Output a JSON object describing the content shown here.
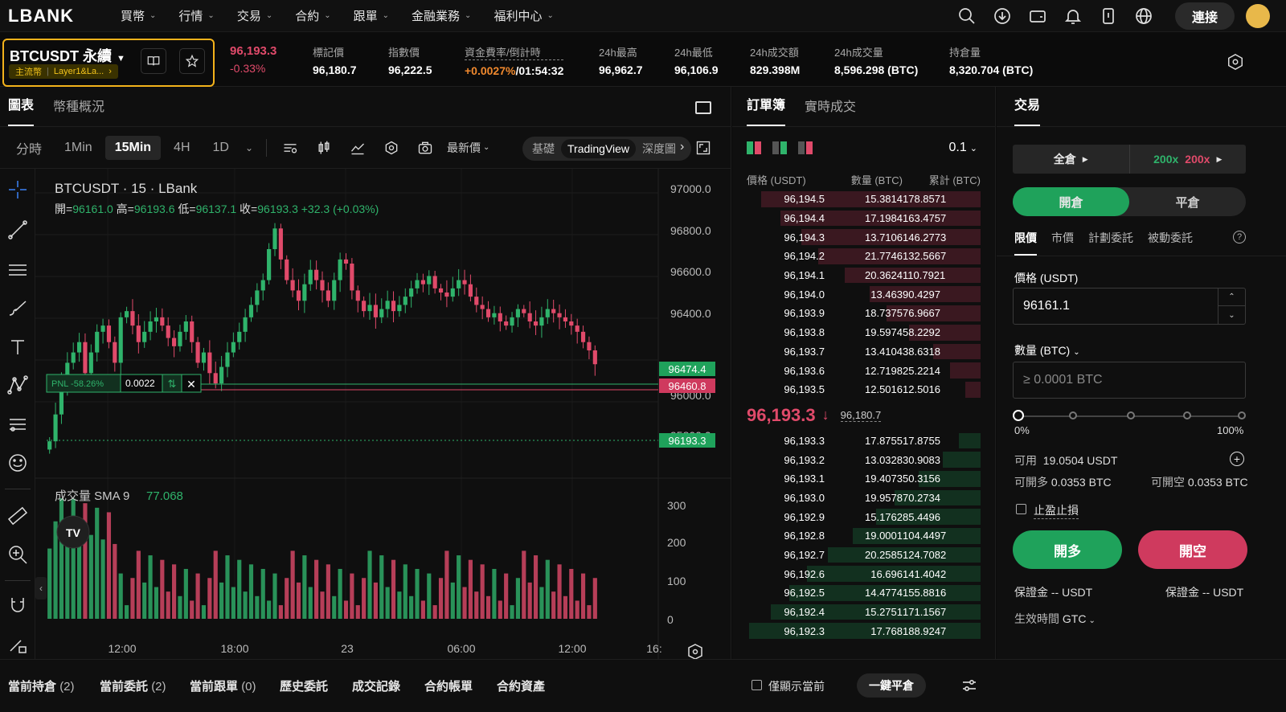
{
  "nav": {
    "logo": "LBANK",
    "items": [
      "買幣",
      "行情",
      "交易",
      "合約",
      "跟單",
      "金融業務",
      "福利中心"
    ],
    "connect": "連接"
  },
  "ticker": {
    "symbol": "BTCUSDT 永續",
    "tag1": "主流幣",
    "tag2": "Layer1&La...",
    "price": "96,193.3",
    "change": "-0.33%",
    "stats": [
      {
        "label": "標記價",
        "value": "96,180.7"
      },
      {
        "label": "指數價",
        "value": "96,222.5"
      },
      {
        "label": "資金費率/倒計時",
        "value": "+0.0027%",
        "value2": "/01:54:32"
      },
      {
        "label": "24h最高",
        "value": "96,962.7"
      },
      {
        "label": "24h最低",
        "value": "96,106.9"
      },
      {
        "label": "24h成交額",
        "value": "829.398M"
      },
      {
        "label": "24h成交量",
        "value": "8,596.298 (BTC)"
      },
      {
        "label": "持倉量",
        "value": "8,320.704 (BTC)"
      }
    ]
  },
  "chart": {
    "tabs": [
      "圖表",
      "幣種概況"
    ],
    "timeframes": [
      "分時",
      "1Min",
      "15Min",
      "4H",
      "1D"
    ],
    "active_timeframe": "15Min",
    "latest": "最新價",
    "modes": [
      "基礎",
      "TradingView",
      "深度圖"
    ],
    "title": "BTCUSDT · 15 · LBank",
    "ohlc": {
      "o_label": "開=",
      "o": "96161.0",
      "h_label": "高=",
      "h": "96193.6",
      "l_label": "低=",
      "l": "96137.1",
      "c_label": "收=",
      "c": "96193.3",
      "chg": "+32.3 (+0.03%)"
    },
    "pnl": {
      "label": "PNL -58.26%",
      "qty": "0.0022"
    },
    "price_axis": [
      "97000.0",
      "96800.0",
      "96600.0",
      "96400.0",
      "96000.0",
      "95800.0"
    ],
    "price_tags": {
      "a": "96474.4",
      "b": "96460.8",
      "c": "96193.3"
    },
    "volume_label": "成交量 SMA 9",
    "volume_value": "77.068",
    "volume_axis": [
      "300",
      "200",
      "100",
      "0"
    ],
    "time_axis": [
      "12:00",
      "18:00",
      "23",
      "06:00",
      "12:00",
      "16:"
    ]
  },
  "chart_data": {
    "type": "bar",
    "title": "BTCUSDT · 15 · LBank",
    "xlabel": "",
    "ylabel": "",
    "ylim": [
      95700,
      97100
    ],
    "note_series": "candlestick close prices (approx)",
    "closes": [
      95820,
      95950,
      96100,
      96200,
      96250,
      96300,
      96150,
      96250,
      96350,
      96380,
      96300,
      96200,
      96420,
      96450,
      96380,
      96300,
      96350,
      96400,
      96420,
      96380,
      96320,
      96280,
      96350,
      96400,
      96300,
      96200,
      96250,
      96150,
      96100,
      96180,
      96250,
      96300,
      96350,
      96420,
      96480,
      96550,
      96600,
      96750,
      96850,
      96700,
      96600,
      96550,
      96500,
      96580,
      96650,
      96600,
      96550,
      96500,
      96600,
      96700,
      96680,
      96550,
      96500,
      96450,
      96480,
      96420,
      96460,
      96500,
      96450,
      96480,
      96520,
      96560,
      96600,
      96580,
      96620,
      96560,
      96540,
      96520,
      96560,
      96600,
      96580,
      96520,
      96480,
      96460,
      96420,
      96440,
      96400,
      96380,
      96420,
      96460,
      96440,
      96400,
      96380,
      96420,
      96460,
      96440,
      96420,
      96400,
      96380,
      96350,
      96300,
      96260,
      96193
    ]
  },
  "orderbook": {
    "tabs": [
      "訂單簿",
      "實時成交"
    ],
    "step": "0.1",
    "headers": [
      "價格 (USDT)",
      "數量 (BTC)",
      "累計 (BTC)"
    ],
    "asks": [
      [
        "96,194.5",
        "15.3814",
        "178.8571"
      ],
      [
        "96,194.4",
        "17.1984",
        "163.4757"
      ],
      [
        "96,194.3",
        "13.7106",
        "146.2773"
      ],
      [
        "96,194.2",
        "21.7746",
        "132.5667"
      ],
      [
        "96,194.1",
        "20.3624",
        "110.7921"
      ],
      [
        "96,194.0",
        "13.463",
        "90.4297"
      ],
      [
        "96,193.9",
        "18.7375",
        "76.9667"
      ],
      [
        "96,193.8",
        "19.5974",
        "58.2292"
      ],
      [
        "96,193.7",
        "13.4104",
        "38.6318"
      ],
      [
        "96,193.6",
        "12.7198",
        "25.2214"
      ],
      [
        "96,193.5",
        "12.5016",
        "12.5016"
      ]
    ],
    "mid_price": "96,193.3",
    "mid_mark": "96,180.7",
    "bids": [
      [
        "96,193.3",
        "17.8755",
        "17.8755"
      ],
      [
        "96,193.2",
        "13.0328",
        "30.9083"
      ],
      [
        "96,193.1",
        "19.4073",
        "50.3156"
      ],
      [
        "96,193.0",
        "19.9578",
        "70.2734"
      ],
      [
        "96,192.9",
        "15.1762",
        "85.4496"
      ],
      [
        "96,192.8",
        "19.0001",
        "104.4497"
      ],
      [
        "96,192.7",
        "20.2585",
        "124.7082"
      ],
      [
        "96,192.6",
        "16.696",
        "141.4042"
      ],
      [
        "96,192.5",
        "14.4774",
        "155.8816"
      ],
      [
        "96,192.4",
        "15.2751",
        "171.1567"
      ],
      [
        "96,192.3",
        "17.768",
        "188.9247"
      ]
    ]
  },
  "trade": {
    "tab": "交易",
    "margin_mode": "全倉",
    "lev_long": "200x",
    "lev_short": "200x",
    "open": "開倉",
    "close": "平倉",
    "order_types": [
      "限價",
      "市價",
      "計劃委託",
      "被動委託"
    ],
    "price_label": "價格 (USDT)",
    "price_value": "96161.1",
    "qty_label": "數量 (BTC)",
    "qty_placeholder": "≥ 0.0001 BTC",
    "pct_min": "0%",
    "pct_max": "100%",
    "available_label": "可用",
    "available": "19.0504 USDT",
    "can_long_label": "可開多",
    "can_long": "0.0353 BTC",
    "can_short_label": "可開空",
    "can_short": "0.0353 BTC",
    "tpsl": "止盈止損",
    "btn_long": "開多",
    "btn_short": "開空",
    "margin_long": "保證金 -- USDT",
    "margin_short": "保證金 -- USDT",
    "tif_label": "生效時間",
    "tif": "GTC"
  },
  "bottom": {
    "tabs": [
      {
        "label": "當前持倉",
        "count": "(2)"
      },
      {
        "label": "當前委託",
        "count": "(2)"
      },
      {
        "label": "當前跟單",
        "count": "(0)"
      },
      {
        "label": "歷史委託",
        "count": ""
      },
      {
        "label": "成交記錄",
        "count": ""
      },
      {
        "label": "合約帳單",
        "count": ""
      },
      {
        "label": "合約資產",
        "count": ""
      }
    ],
    "only_current": "僅顯示當前",
    "close_all": "一鍵平倉"
  },
  "colors": {
    "up": "#2fb36b",
    "down": "#e04a6a",
    "accent": "#f3b21b"
  }
}
